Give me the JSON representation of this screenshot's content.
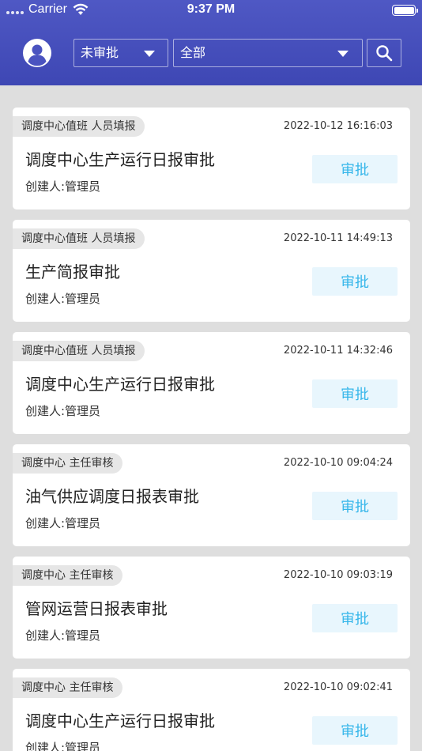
{
  "status_bar": {
    "carrier": "Carrier",
    "time": "9:37 PM"
  },
  "filters": {
    "status_value": "未审批",
    "type_value": "全部"
  },
  "items": [
    {
      "tag": "调度中心值班 人员填报",
      "date": "2022-10-12 16:16:03",
      "title": "调度中心生产运行日报审批",
      "creator": "创建人:管理员",
      "action": "审批"
    },
    {
      "tag": "调度中心值班 人员填报",
      "date": "2022-10-11 14:49:13",
      "title": "生产简报审批",
      "creator": "创建人:管理员",
      "action": "审批"
    },
    {
      "tag": "调度中心值班 人员填报",
      "date": "2022-10-11 14:32:46",
      "title": "调度中心生产运行日报审批",
      "creator": "创建人:管理员",
      "action": "审批"
    },
    {
      "tag": "调度中心 主任审核",
      "date": "2022-10-10 09:04:24",
      "title": "油气供应调度日报表审批",
      "creator": "创建人:管理员",
      "action": "审批"
    },
    {
      "tag": "调度中心 主任审核",
      "date": "2022-10-10 09:03:19",
      "title": "管网运营日报表审批",
      "creator": "创建人:管理员",
      "action": "审批"
    },
    {
      "tag": "调度中心 主任审核",
      "date": "2022-10-10 09:02:41",
      "title": "调度中心生产运行日报审批",
      "creator": "创建人:管理员",
      "action": "审批"
    }
  ],
  "colors": {
    "header": "#4f58c4",
    "approve_text": "#35b6ea",
    "approve_bg": "#e8f6fd"
  }
}
